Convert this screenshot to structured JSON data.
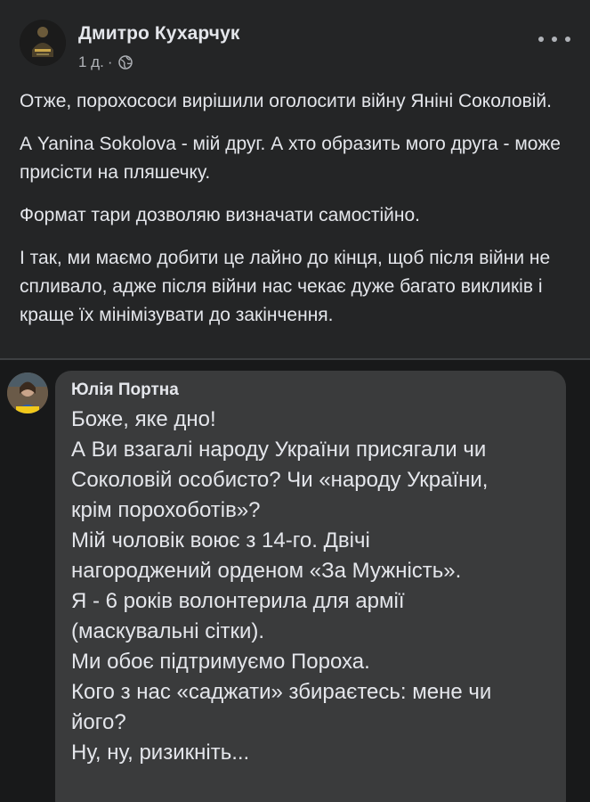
{
  "post": {
    "author": "Дмитро Кухарчук",
    "time": "1 д.",
    "separator": "·",
    "privacy_icon": "globe-icon",
    "more_icon": "more-options-icon",
    "paragraphs": [
      "Отже, порохососи вирішили оголосити війну Яніні Соколовій.",
      "А Yanina Sokolova - мій друг. А хто образить мого друга - може присісти на пляшечку.",
      "Формат тари дозволяю визначати самостійно.",
      "І так, ми маємо добити це лайно до кінця, щоб після війни не спливало, адже після війни нас чекає дуже багато викликів і краще їх мінімізувати до закінчення."
    ]
  },
  "comment": {
    "author": "Юлія Портна",
    "lines": [
      "Боже, яке дно!",
      "А Ви взагалі народу України присягали чи",
      "Соколовій особисто? Чи «народу України,",
      "крім порохоботів»?",
      "Мій чоловік воює з 14-го. Двічі",
      "нагороджений орденом «За Мужність».",
      "Я - 6 років волонтерила для армії",
      "(маскувальні сітки).",
      "Ми обоє підтримуємо Пороха.",
      "Кого з нас «саджати» збираєтесь: мене чи",
      "його?",
      "Ну, ну, ризикніть..."
    ]
  },
  "colors": {
    "background": "#18191a",
    "card": "#242526",
    "bubble": "#3a3b3c",
    "text_primary": "#e4e6eb",
    "text_secondary": "#b0b3b8"
  }
}
